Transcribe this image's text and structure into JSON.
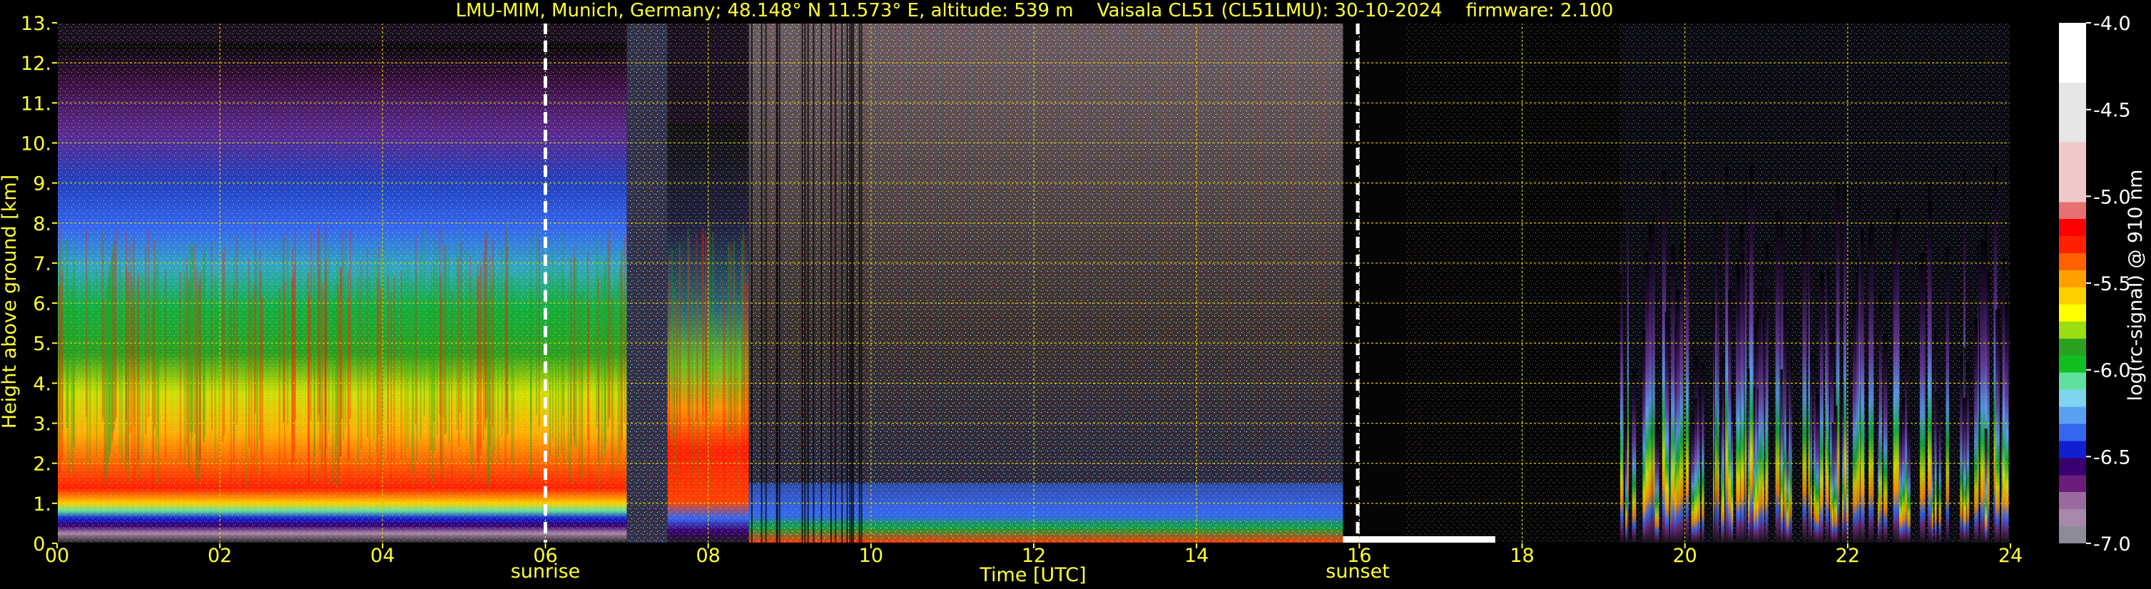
{
  "chart_data": {
    "type": "heatmap",
    "title": "LMU-MIM, Munich, Germany; 48.148° N 11.573° E, altitude: 539 m    Vaisala CL51 (CL51LMU): 30-10-2024    firmware: 2.100",
    "xlabel": "Time [UTC]",
    "ylabel": "Height above ground [km]",
    "xlim": [
      0,
      24
    ],
    "ylim": [
      0,
      13
    ],
    "x_ticks": [
      0,
      2,
      4,
      6,
      8,
      10,
      12,
      14,
      16,
      18,
      20,
      22,
      24
    ],
    "x_tick_labels": [
      "00",
      "02",
      "04",
      "06",
      "08",
      "10",
      "12",
      "14",
      "16",
      "18",
      "20",
      "22",
      "24"
    ],
    "y_ticks": [
      0,
      1,
      2,
      3,
      4,
      5,
      6,
      7,
      8,
      9,
      10,
      11,
      12,
      13
    ],
    "y_tick_labels": [
      "0.",
      "1.",
      "2.",
      "3.",
      "4.",
      "5.",
      "6.",
      "7.",
      "8.",
      "9.",
      "10.",
      "11.",
      "12.",
      "13."
    ],
    "grid": true,
    "colorbar": {
      "label": "log(rc-signal) @ 910 nm",
      "range": [
        -7.0,
        -4.0
      ],
      "tick_values": [
        -7.0,
        -6.5,
        -6.0,
        -5.5,
        -5.0,
        -4.5,
        -4.0
      ],
      "tick_labels": [
        "-7.0",
        "-6.5",
        "-6.0",
        "-5.5",
        "-5.0",
        "-4.5",
        "-4.0"
      ],
      "colors": [
        "#8c8c98",
        "#a888aa",
        "#9a6aa0",
        "#6a1d7a",
        "#3a0070",
        "#1020d0",
        "#3466f0",
        "#5aa0f0",
        "#7fd4f0",
        "#60e0a0",
        "#10c020",
        "#2aa020",
        "#9add10",
        "#ffff00",
        "#ffd000",
        "#ffa000",
        "#ff6000",
        "#ff2000",
        "#ff0000",
        "#e87070",
        "#f0c8c8",
        "#e6e6e6",
        "#ffffff"
      ]
    },
    "events": [
      {
        "label": "sunrise",
        "time": 6.0
      },
      {
        "label": "sunset",
        "time": 15.98
      }
    ],
    "profiles": [
      {
        "t0": 0.0,
        "t1": 7.0,
        "kind": "aerosol",
        "top_km": 7.5
      },
      {
        "t0": 7.0,
        "t1": 7.5,
        "kind": "noisy"
      },
      {
        "t0": 7.5,
        "t1": 8.5,
        "kind": "aerosol",
        "top_km": 5.5
      },
      {
        "t0": 8.5,
        "t1": 15.8,
        "kind": "daylight_noise"
      },
      {
        "t0": 15.8,
        "t1": 19.2,
        "kind": "dark"
      },
      {
        "t0": 19.2,
        "t1": 24.0,
        "kind": "streaks",
        "top_km": 9.5
      }
    ]
  }
}
